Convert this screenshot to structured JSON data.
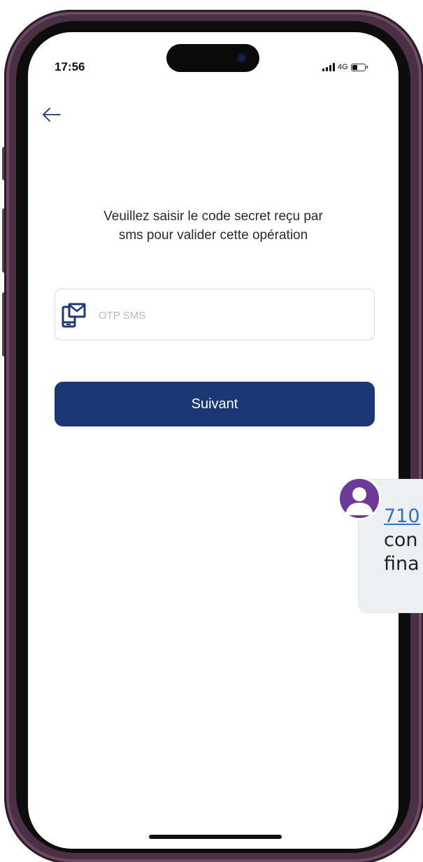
{
  "status_bar": {
    "time": "17:56",
    "network": "4G",
    "battery_level": 0.45,
    "signal_bars": 4
  },
  "header": {
    "back_icon": "arrow-left-icon"
  },
  "main": {
    "instruction_line1": "Veuillez saisir le code secret reçu par",
    "instruction_line2": "sms pour valider cette opération",
    "otp_field": {
      "icon": "phone-message-icon",
      "placeholder": "OTP SMS",
      "value": ""
    },
    "next_button_label": "Suivant"
  },
  "sms_notification": {
    "avatar_icon": "person-icon",
    "line1": "710",
    "line2": "con",
    "line3": "fina"
  },
  "colors": {
    "primary": "#1c3775",
    "frame": "#4a2f45",
    "avatar": "#6c3b9a",
    "link": "#2f74c0"
  }
}
